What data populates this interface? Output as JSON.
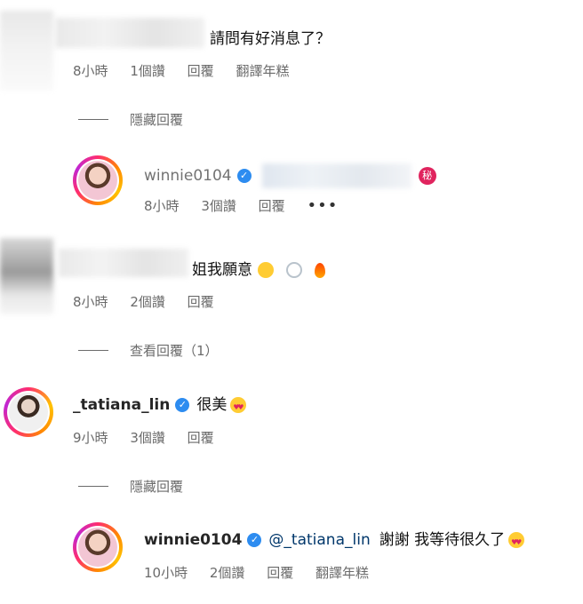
{
  "comments": [
    {
      "text": "請問有好消息了？",
      "meta": {
        "time": "8小時",
        "likes": "1個讚",
        "reply": "回覆",
        "translate": "翻譯年糕"
      },
      "toggle": "隱藏回覆",
      "reply": {
        "username": "winnie0104",
        "meta": {
          "time": "8小時",
          "likes": "3個讚",
          "reply": "回覆"
        },
        "more": "•••"
      }
    },
    {
      "text": "姐我願意",
      "meta": {
        "time": "8小時",
        "likes": "2個讚",
        "reply": "回覆"
      },
      "toggle": "查看回覆（1）"
    },
    {
      "username": "_tatiana_lin",
      "text": "很美",
      "meta": {
        "time": "9小時",
        "likes": "3個讚",
        "reply": "回覆"
      },
      "toggle": "隱藏回覆",
      "reply": {
        "username": "winnie0104",
        "mention": "@_tatiana_lin",
        "text": "謝謝 我等待很久了",
        "meta": {
          "time": "10小時",
          "likes": "2個讚",
          "reply": "回覆",
          "translate": "翻譯年糕"
        }
      }
    }
  ],
  "colors": {
    "verified": "#2d8cf0",
    "meta": "#6b6b6b",
    "ring_start": "#ff2d6f",
    "ring_end": "#ffc300"
  },
  "icons": [
    "verified-badge-icon",
    "heart-eyes-emoji",
    "pleading-emoji",
    "ring-emoji",
    "fire-emoji",
    "secret-emoji"
  ]
}
